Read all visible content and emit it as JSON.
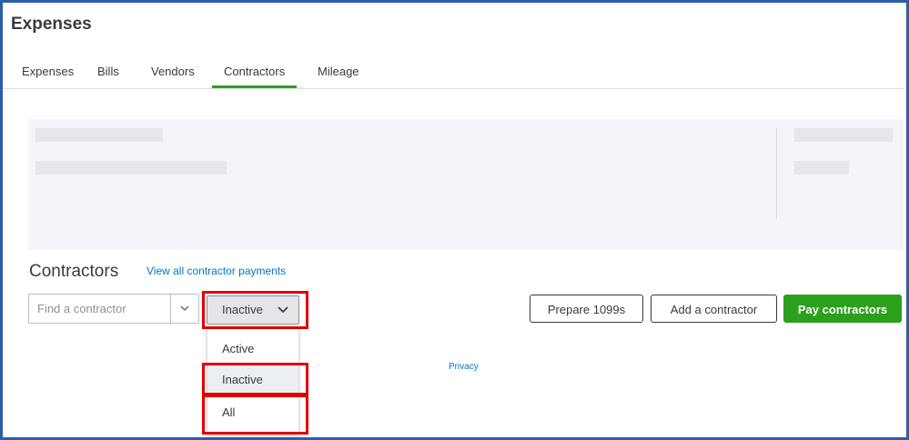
{
  "header": {
    "title": "Expenses"
  },
  "tabs": [
    {
      "label": "Expenses",
      "active": false
    },
    {
      "label": "Bills",
      "active": false
    },
    {
      "label": "Vendors",
      "active": false
    },
    {
      "label": "Contractors",
      "active": true
    },
    {
      "label": "Mileage",
      "active": false
    }
  ],
  "section": {
    "title": "Contractors",
    "view_link": "View all contractor payments"
  },
  "search": {
    "placeholder": "Find a contractor",
    "value": "",
    "caret_icon": "chevron-down-icon"
  },
  "filter": {
    "selected": "Inactive",
    "chevron_icon": "chevron-down-icon",
    "options": [
      {
        "label": "Active",
        "selected": false
      },
      {
        "label": "Inactive",
        "selected": true
      },
      {
        "label": "All",
        "selected": false
      }
    ]
  },
  "actions": {
    "prepare_label": "Prepare 1099s",
    "add_label": "Add a contractor",
    "pay_label": "Pay contractors"
  },
  "footer": {
    "privacy": "Privacy"
  },
  "colors": {
    "accent_green": "#2ca01c",
    "link_blue": "#0077c5",
    "highlight_red": "#e00000",
    "frame_blue": "#2a5fa5"
  }
}
